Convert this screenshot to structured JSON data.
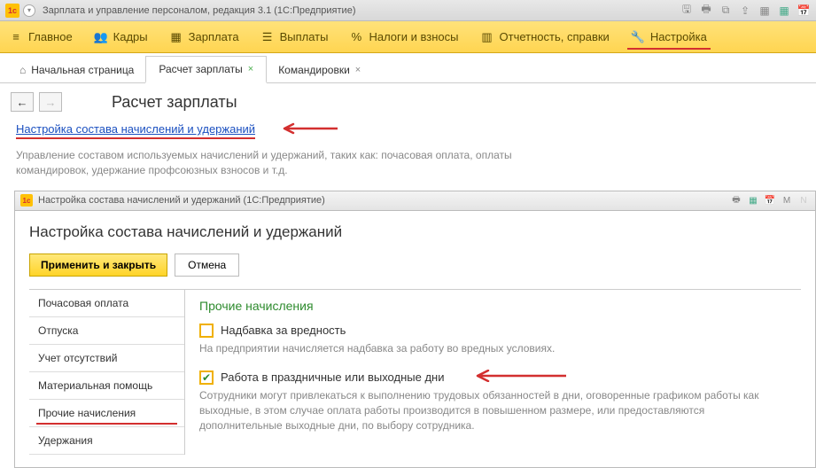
{
  "app": {
    "title": "Зарплата и управление персоналом, редакция 3.1  (1С:Предприятие)"
  },
  "nav": {
    "main": "Главное",
    "kadry": "Кадры",
    "zarplata": "Зарплата",
    "vyplaty": "Выплаты",
    "nalogi": "Налоги и взносы",
    "otchet": "Отчетность, справки",
    "nastroika": "Настройка"
  },
  "tabs": {
    "home": "Начальная страница",
    "t1": "Расчет зарплаты",
    "t2": "Командировки"
  },
  "page": {
    "title": "Расчет зарплаты",
    "link": "Настройка состава начислений и удержаний",
    "desc": "Управление составом используемых начислений и удержаний, таких как: почасовая оплата, оплаты командировок, удержание профсоюзных взносов и т.д."
  },
  "modal": {
    "title": "Настройка состава начислений и удержаний  (1С:Предприятие)",
    "h1": "Настройка состава начислений и удержаний",
    "apply": "Применить и закрыть",
    "cancel": "Отмена",
    "left": {
      "i0": "Почасовая оплата",
      "i1": "Отпуска",
      "i2": "Учет отсутствий",
      "i3": "Материальная помощь",
      "i4": "Прочие начисления",
      "i5": "Удержания"
    },
    "section": {
      "title": "Прочие начисления",
      "chk1_label": "Надбавка за вредность",
      "chk1_desc": "На предприятии начисляется надбавка за работу во вредных условиях.",
      "chk2_label": "Работа в праздничные или выходные дни",
      "chk2_desc": "Сотрудники могут привлекаться к выполнению трудовых обязанностей в дни, оговоренные графиком работы как выходные, в этом случае оплата работы производится в повышенном размере, или предоставляются дополнительные выходные дни, по выбору сотрудника."
    }
  }
}
